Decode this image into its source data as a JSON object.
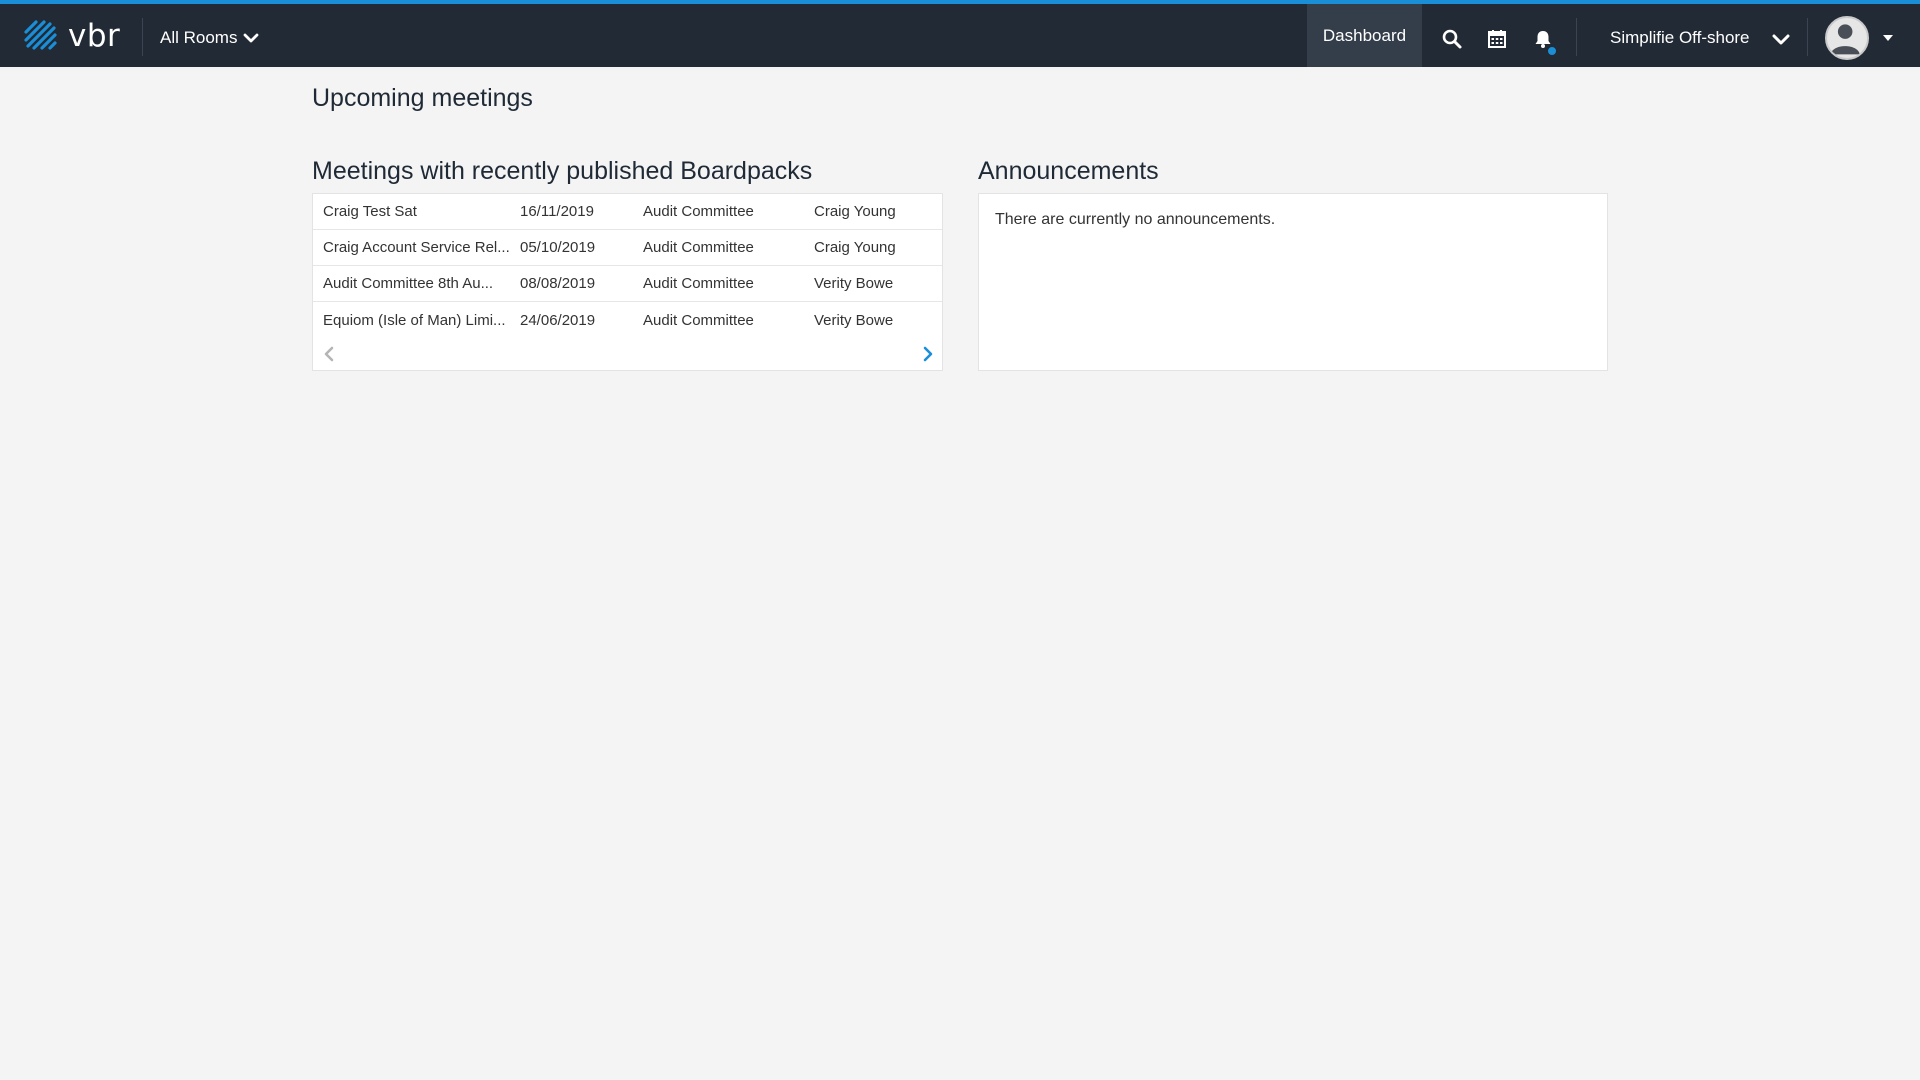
{
  "app": {
    "logo_text": "vbr"
  },
  "nav": {
    "rooms_label": "All Rooms",
    "dashboard_label": "Dashboard",
    "org_label": "Simplifie Off-shore"
  },
  "colors": {
    "accent": "#1a8fd8",
    "nav_bg": "#222a35",
    "page_bg": "#f4f4f4"
  },
  "page": {
    "title": "Upcoming meetings",
    "meetings_heading": "Meetings with recently published Boardpacks",
    "announcements_heading": "Announcements",
    "announcements_empty": "There are currently no announcements."
  },
  "meetings": [
    {
      "name": "Craig Test Sat",
      "date": "16/11/2019",
      "committee": "Audit Committee",
      "person": "Craig Young"
    },
    {
      "name": "Craig Account Service Rel...",
      "date": "05/10/2019",
      "committee": "Audit Committee",
      "person": "Craig Young"
    },
    {
      "name": "Audit Committee 8th Au...",
      "date": "08/08/2019",
      "committee": "Audit Committee",
      "person": "Verity Bowe"
    },
    {
      "name": "Equiom (Isle of Man) Limi...",
      "date": "24/06/2019",
      "committee": "Audit Committee",
      "person": "Verity Bowe"
    }
  ],
  "icons": [
    "vbr-logo-icon",
    "chevron-down-icon",
    "search-icon",
    "calendar-icon",
    "bell-icon",
    "user-avatar-icon",
    "chevron-left-icon",
    "chevron-right-icon"
  ]
}
